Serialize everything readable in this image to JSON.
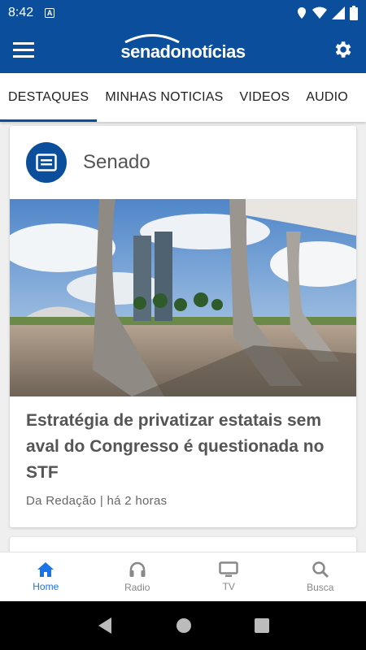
{
  "status": {
    "time": "8:42",
    "notification_badge": "A"
  },
  "app_bar": {
    "logo_part1": "senado",
    "logo_part2": "notícias"
  },
  "tabs": [
    {
      "label": "DESTAQUES",
      "active": true
    },
    {
      "label": "MINHAS NOTICIAS"
    },
    {
      "label": "VIDEOS"
    },
    {
      "label": "AUDIO"
    }
  ],
  "card": {
    "section": "Senado",
    "headline": "Estratégia de privatizar estatais sem aval do Congresso é questionada no STF",
    "meta": "Da Redação | há 2 horas"
  },
  "bottom_nav": [
    {
      "label": "Home",
      "icon": "home-icon",
      "active": true
    },
    {
      "label": "Radio",
      "icon": "headphones-icon"
    },
    {
      "label": "TV",
      "icon": "tv-icon"
    },
    {
      "label": "Busca",
      "icon": "search-icon"
    }
  ],
  "colors": {
    "primary": "#0b4f9c",
    "active_nav": "#1a73e8"
  }
}
